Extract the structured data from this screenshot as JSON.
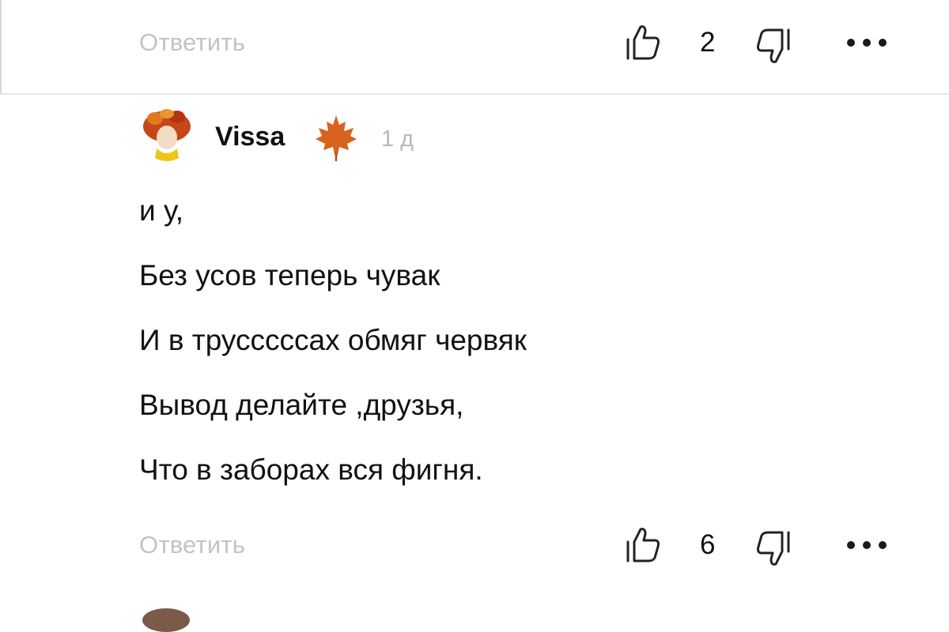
{
  "top_actions": {
    "reply_label": "Ответить",
    "like_count": "2"
  },
  "comment": {
    "author": "Vissa",
    "time_ago": "1 д",
    "lines": [
      "и у,",
      "Без усов теперь чувак",
      "И в трусссссах обмяг червяк",
      "Вывод делайте ,друзья,",
      "Что в заборах вся фигня."
    ],
    "reply_label": "Ответить",
    "like_count": "6"
  },
  "icons": {
    "like": "thumbs-up-icon",
    "dislike": "thumbs-down-icon",
    "more": "more-dots-icon",
    "badge": "maple-leaf-icon"
  },
  "colors": {
    "muted_text": "#c3c3c3",
    "timestamp": "#b8b8b8",
    "leaf": "#d9621c"
  }
}
